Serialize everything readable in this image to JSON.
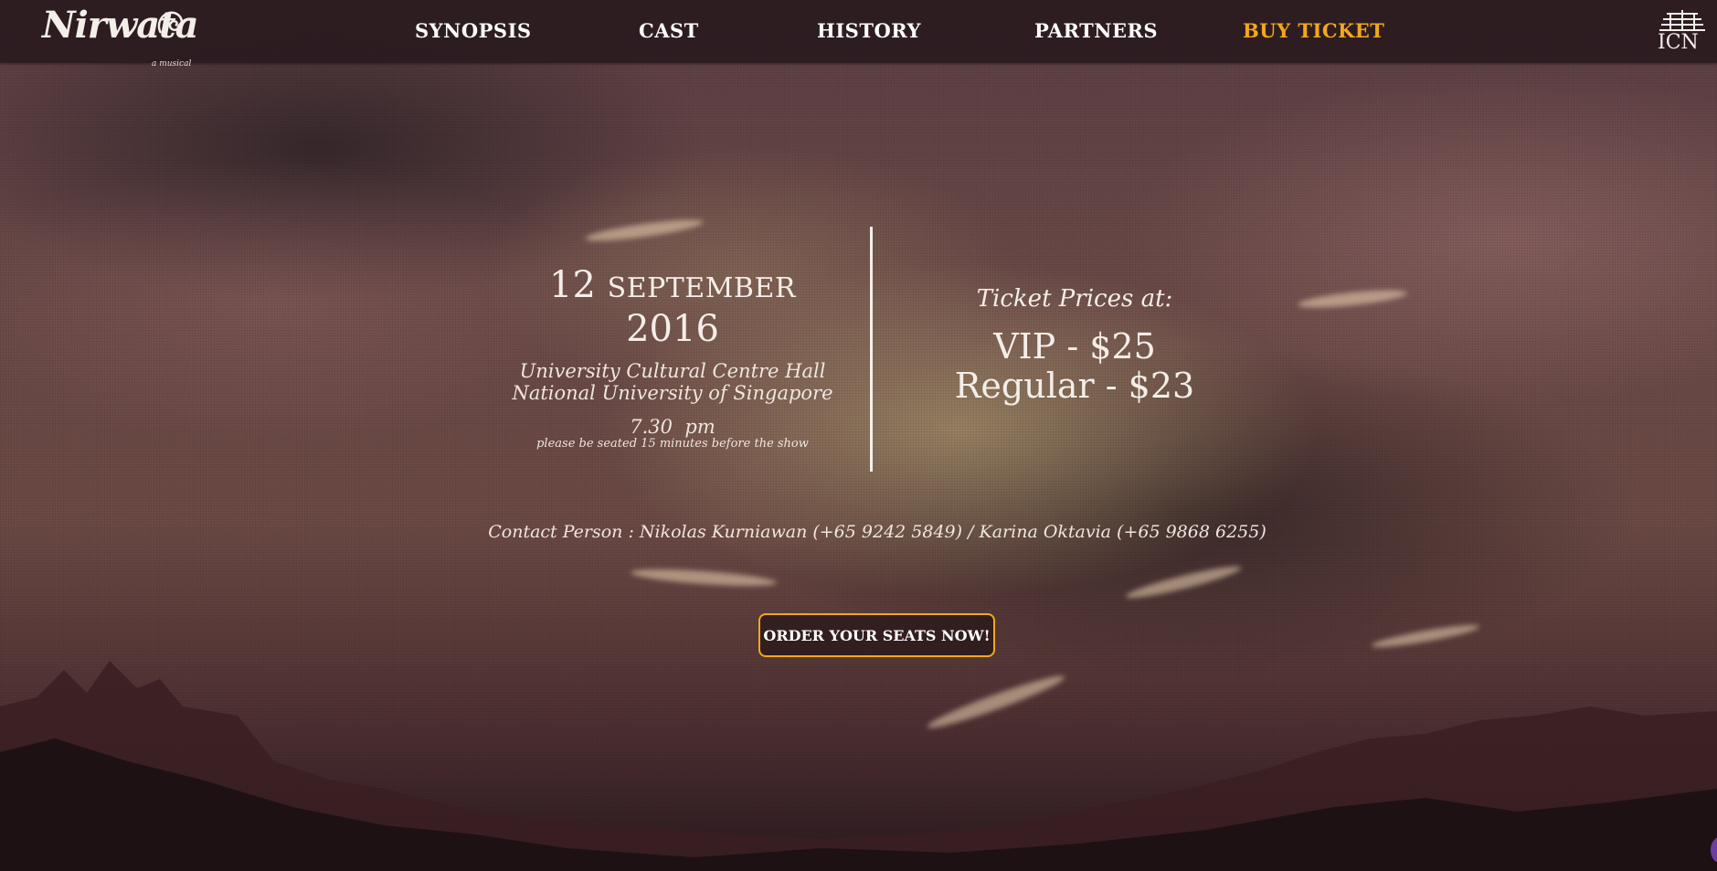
{
  "brand": {
    "logo_text": "Nirwata",
    "logo_subtext": "a musical",
    "partner_logo_text": "ICN"
  },
  "nav": {
    "items": [
      {
        "label": "SYNOPSIS"
      },
      {
        "label": "CAST"
      },
      {
        "label": "HISTORY"
      },
      {
        "label": "PARTNERS"
      },
      {
        "label": "BUY TICKET",
        "active": true
      }
    ]
  },
  "event": {
    "date_day": "12",
    "date_month": "SEPTEMBER",
    "date_year": "2016",
    "venue_line1": "University Cultural Centre Hall",
    "venue_line2": "National University of Singapore",
    "time": "7.30  pm",
    "time_note": "please be seated 15 minutes before the show"
  },
  "tickets": {
    "label": "Ticket Prices at:",
    "vip": "VIP - $25",
    "regular": "Regular - $23"
  },
  "contact": {
    "text": "Contact Person : Nikolas Kurniawan (+65 9242 5849) / Karina Oktavia (+65 9868 6255)"
  },
  "cta": {
    "label": "ORDER YOUR SEATS NOW!"
  },
  "colors": {
    "accent": "#f2a81c",
    "navbar": "#2a1b1f",
    "text": "#f4eee8"
  }
}
